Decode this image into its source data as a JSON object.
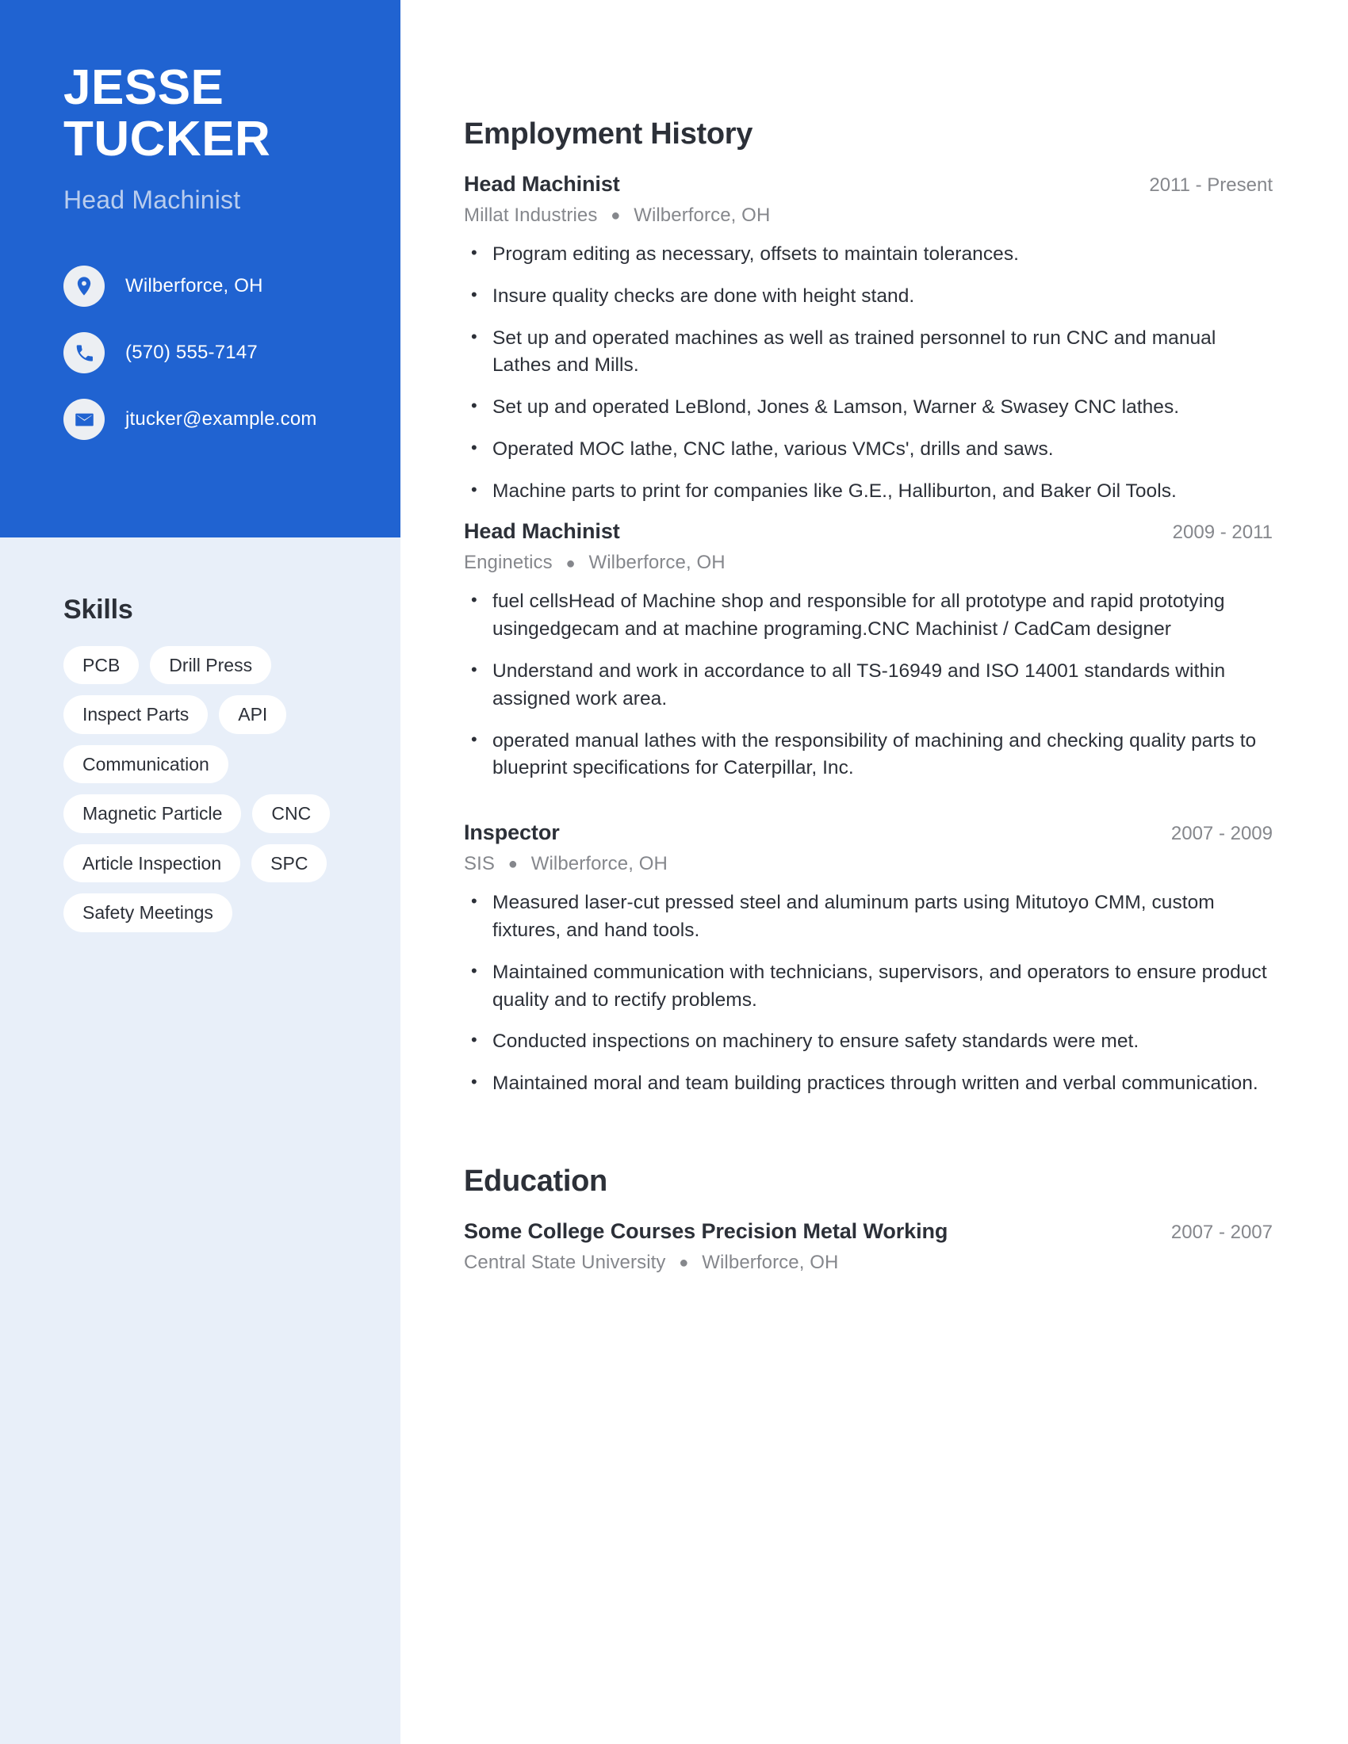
{
  "colors": {
    "header_blue": "#2063d1",
    "sidebar_blue": "#e8eff9",
    "text_dark": "#2c3038",
    "text_muted": "#85878c",
    "subtitle_blue": "#b9cdee"
  },
  "sidebar": {
    "name_first": "JESSE",
    "name_last": "TUCKER",
    "job_title": "Head Machinist",
    "contacts": [
      {
        "icon": "location-pin-icon",
        "text": "Wilberforce, OH"
      },
      {
        "icon": "phone-icon",
        "text": "(570) 555-7147"
      },
      {
        "icon": "envelope-icon",
        "text": "jtucker@example.com"
      }
    ],
    "skills_heading": "Skills",
    "skills": [
      "PCB",
      "Drill Press",
      "Inspect Parts",
      "API",
      "Communication",
      "Magnetic Particle",
      "CNC",
      "Article Inspection",
      "SPC",
      "Safety Meetings"
    ]
  },
  "main": {
    "employment_heading": "Employment History",
    "education_heading": "Education",
    "separator": "●",
    "jobs": [
      {
        "title": "Head Machinist",
        "date": "2011 - Present",
        "company": "Millat Industries",
        "location": "Wilberforce, OH",
        "bullets": [
          "Program editing as necessary, offsets to maintain tolerances.",
          "Insure quality checks are done with height stand.",
          "Set up and operated machines as well as trained personnel to run CNC and manual Lathes and Mills.",
          "Set up and operated LeBlond, Jones & Lamson, Warner & Swasey CNC lathes.",
          "Operated MOC lathe, CNC lathe, various VMCs', drills and saws.",
          "Machine parts to print for companies like G.E., Halliburton, and Baker Oil Tools."
        ]
      },
      {
        "title": "Head Machinist",
        "date": "2009 - 2011",
        "company": "Enginetics",
        "location": "Wilberforce, OH",
        "bullets": [
          "fuel cellsHead of Machine shop and responsible for all prototype and rapid prototying usingedgecam and at machine programing.CNC Machinist / CadCam designer",
          "Understand and work in accordance to all TS-16949 and ISO 14001 standards within assigned work area.",
          "operated manual lathes with the responsibility of machining and checking quality parts to blueprint specifications for Caterpillar, Inc."
        ]
      },
      {
        "title": "Inspector",
        "date": "2007 - 2009",
        "company": "SIS",
        "location": "Wilberforce, OH",
        "bullets": [
          "Measured laser-cut pressed steel and aluminum parts using Mitutoyo CMM, custom fixtures, and hand tools.",
          "Maintained communication with technicians, supervisors, and operators to ensure product quality and to rectify problems.",
          "Conducted inspections on machinery to ensure safety standards were met.",
          "Maintained moral and team building practices through written and verbal communication."
        ]
      }
    ],
    "education": [
      {
        "title": "Some College Courses Precision Metal Working",
        "date": "2007 - 2007",
        "school": "Central State University",
        "location": "Wilberforce, OH"
      }
    ]
  }
}
